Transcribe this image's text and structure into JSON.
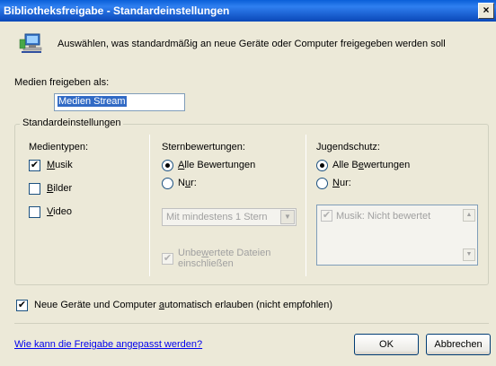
{
  "window": {
    "title": "Bibliotheksfreigabe - Standardeinstellungen",
    "close_label": "×"
  },
  "header": {
    "icon": "network-computer-icon",
    "text": "Auswählen, was standardmäßig an neue Geräte oder Computer freigegeben werden soll"
  },
  "share_as": {
    "label": "Medien freigeben als:",
    "value": "Medien Stream"
  },
  "defaults_group": {
    "title": "Standardeinstellungen",
    "media_types": {
      "label": "Medientypen:",
      "items": [
        {
          "label_pre": "",
          "label_u": "M",
          "label_post": "usik",
          "checked": true
        },
        {
          "label_pre": "",
          "label_u": "B",
          "label_post": "ilder",
          "checked": false
        },
        {
          "label_pre": "",
          "label_u": "V",
          "label_post": "ideo",
          "checked": false
        }
      ]
    },
    "star_ratings": {
      "label": "Sternbewertungen:",
      "all_pre": "",
      "all_u": "A",
      "all_post": "lle Bewertungen",
      "only_pre": "N",
      "only_u": "u",
      "only_post": "r:",
      "selected": "all",
      "dropdown_value": "Mit mindestens 1 Stern",
      "unrated_line1_pre": "Unbe",
      "unrated_line1_u": "w",
      "unrated_line1_post": "ertete Dateien",
      "unrated_line2": "einschließen",
      "unrated_checked": true
    },
    "parental": {
      "label": "Jugendschutz:",
      "all_pre": "Alle B",
      "all_u": "e",
      "all_post": "wertungen",
      "only_pre": "",
      "only_u": "N",
      "only_post": "ur:",
      "selected": "all",
      "list_item": "Musik: Nicht bewertet",
      "list_item_checked": true
    }
  },
  "auto_allow": {
    "pre": "Neue Geräte und Computer ",
    "u": "a",
    "post": "utomatisch erlauben (nicht empfohlen)",
    "checked": true
  },
  "footer": {
    "link": "Wie kann die Freigabe angepasst werden?",
    "ok": "OK",
    "cancel": "Abbrechen"
  },
  "colors": {
    "titlebar": "#0a5fd8",
    "selection": "#316ac5",
    "link": "#0000ee"
  }
}
